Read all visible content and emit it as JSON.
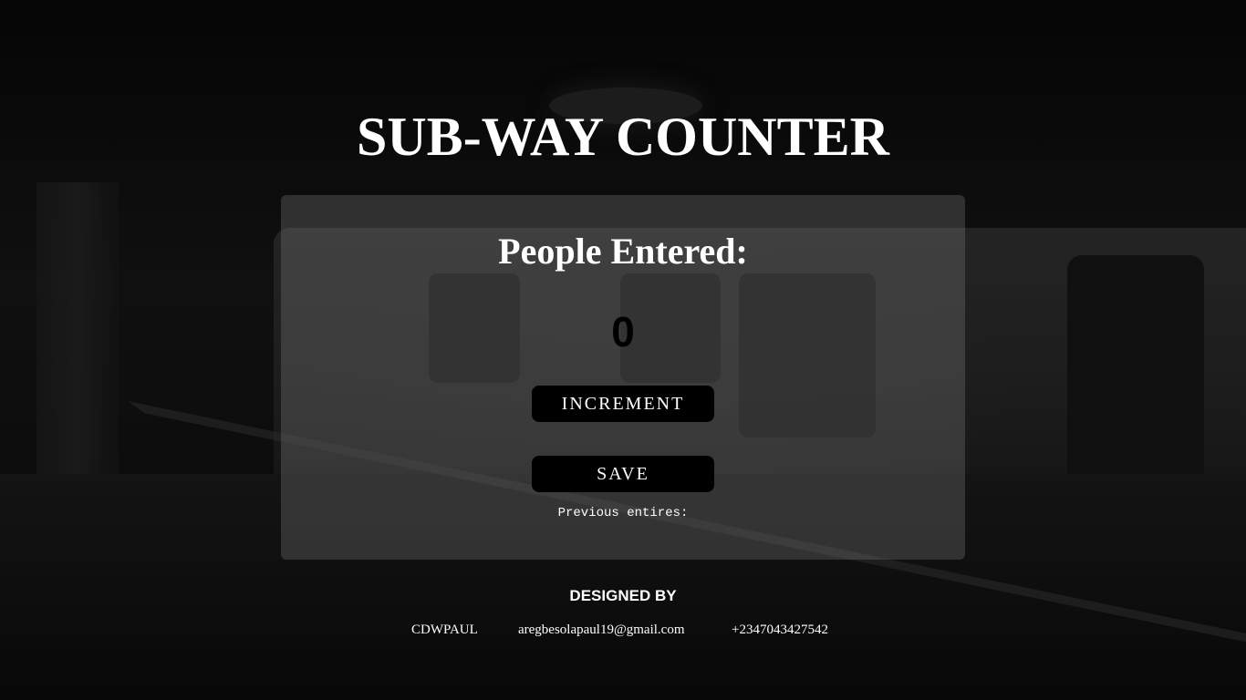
{
  "app": {
    "title": "SUB-WAY COUNTER"
  },
  "counter": {
    "heading": "People Entered:",
    "count": "0",
    "increment_label": "INCREMENT",
    "save_label": "SAVE",
    "previous_entries_label": "Previous entires:"
  },
  "footer": {
    "heading": "DESIGNED BY",
    "name": "CDWPAUL",
    "email": "aregbesolapaul19@gmail.com",
    "phone": "+2347043427542"
  },
  "colors": {
    "button_background": "#000000",
    "text": "#ffffff",
    "count_text": "#000000"
  }
}
